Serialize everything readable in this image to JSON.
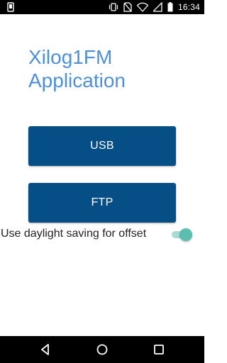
{
  "status_bar": {
    "time": "16:34",
    "icons": [
      "notification-icon",
      "vibrate-icon",
      "no-sim-icon",
      "wifi-icon",
      "signal-icon",
      "battery-icon"
    ]
  },
  "app": {
    "title": "Xilog1FM Application",
    "title_color": "#4e8fd8",
    "button_color": "#064f86",
    "accent_color": "#5bbfb0"
  },
  "buttons": {
    "usb_label": "USB",
    "ftp_label": "FTP"
  },
  "daylight_saving": {
    "label": "Use daylight saving for offset",
    "enabled": true
  },
  "nav_bar": {
    "icons": [
      "back-icon",
      "home-icon",
      "recent-apps-icon"
    ]
  }
}
